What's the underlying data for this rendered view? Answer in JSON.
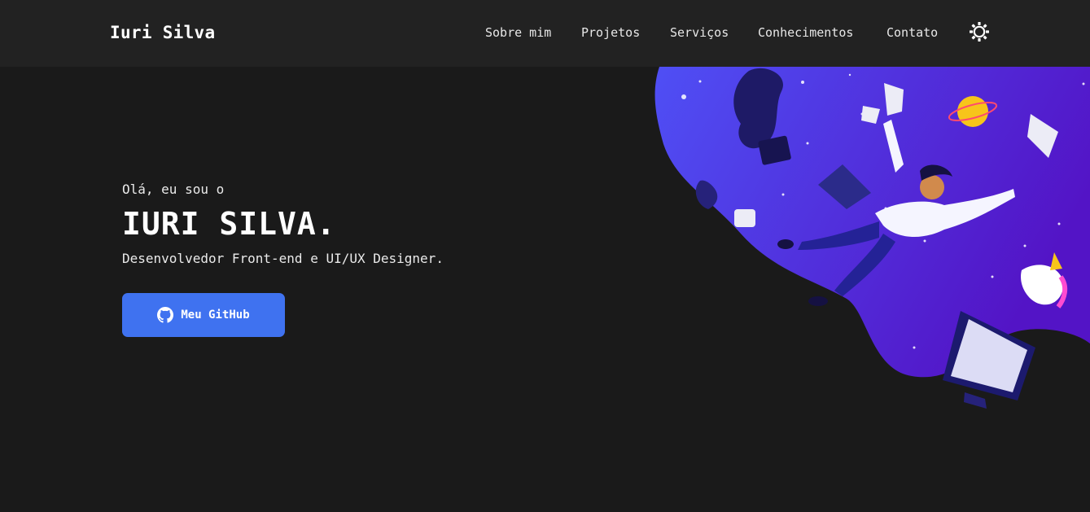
{
  "header": {
    "brand": "Iuri Silva",
    "nav": [
      {
        "label": "Sobre mim"
      },
      {
        "label": "Projetos"
      },
      {
        "label": "Serviços"
      },
      {
        "label": "Conhecimentos"
      },
      {
        "label": "Contato"
      }
    ],
    "theme_toggle_icon": "sun-icon"
  },
  "hero": {
    "greeting": "Olá, eu sou o",
    "name": "IURI SILVA.",
    "role": "Desenvolvedor Front-end e UI/UX Designer.",
    "cta": {
      "label": "Meu GitHub",
      "icon": "github-icon"
    }
  },
  "illustration": {
    "icon": "floating-developer-illustration"
  },
  "colors": {
    "background": "#1a1a1a",
    "header": "#222222",
    "accent": "#3f72f0",
    "illustration_start": "#4f4ff5",
    "illustration_end": "#5314c6"
  }
}
